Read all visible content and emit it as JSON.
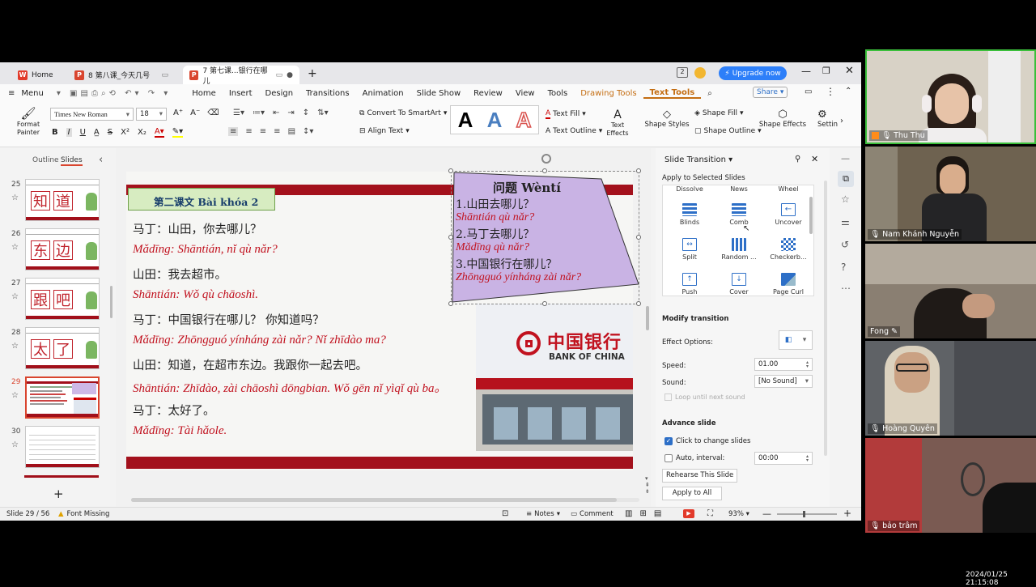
{
  "tabs": {
    "home": "Home",
    "doc1": "8 第八课_今天几号",
    "doc2": "7 第七课...银行在哪儿",
    "new_tab": "+"
  },
  "titlebar": {
    "upgrade": "Upgrade now",
    "badge": "2"
  },
  "menubar": {
    "menu": "Menu",
    "items": [
      "Home",
      "Insert",
      "Design",
      "Transitions",
      "Animation",
      "Slide Show",
      "Review",
      "View",
      "Tools",
      "Drawing Tools",
      "Text Tools"
    ],
    "share": "Share"
  },
  "ribbon": {
    "format_painter": "Format Painter",
    "font_name": "Times New Roman",
    "font_size": "18",
    "convert_smartart": "Convert To SmartArt",
    "align_text": "Align Text",
    "text_fill": "Text Fill",
    "text_outline": "Text Outline",
    "text_effects": "Text Effects",
    "shape_styles": "Shape Styles",
    "shape_fill": "Shape Fill",
    "shape_outline": "Shape Outline",
    "shape_effects": "Shape Effects",
    "settings": "Settin"
  },
  "sidebar": {
    "outline_tab": "Outline",
    "slides_tab": "Slides",
    "slides": [
      {
        "num": "25",
        "chars": [
          "知",
          "道"
        ]
      },
      {
        "num": "26",
        "chars": [
          "东",
          "边"
        ]
      },
      {
        "num": "27",
        "chars": [
          "跟",
          "吧"
        ]
      },
      {
        "num": "28",
        "chars": [
          "太",
          "了"
        ]
      },
      {
        "num": "29",
        "chars": []
      },
      {
        "num": "30",
        "chars": []
      }
    ],
    "add": "+"
  },
  "slide": {
    "title": "第二课文  Bài khóa 2",
    "lines": [
      {
        "cn": "马丁：山田，你去哪儿？",
        "py": "Mǎdīng: Shāntián, nǐ qù nǎr?"
      },
      {
        "cn": "山田：我去超市。",
        "py": "Shāntián: Wǒ qù chāoshì."
      },
      {
        "cn": "马丁：中国银行在哪儿？  你知道吗？",
        "py": "Mǎdīng: Zhōngguó yínháng zài nǎr? Nǐ zhīdào ma?"
      },
      {
        "cn": "山田：知道，在超市东边。我跟你一起去吧。",
        "py": "Shāntián: Zhīdào, zài chāoshì dōngbian. Wǒ gēn nǐ yìqǐ qù ba。"
      },
      {
        "cn": "马丁：太好了。",
        "py": "Mǎdīng: Tài hǎole."
      }
    ],
    "wenti": {
      "title": "问题 Wèntí",
      "items": [
        {
          "cn": "1.山田去哪儿？",
          "py": "Shāntián qù nǎr?"
        },
        {
          "cn": "2.马丁去哪儿？",
          "py": "Mǎdīng qù nǎr?"
        },
        {
          "cn": "3.中国银行在哪儿？",
          "py": "Zhōngguó yínháng zài nǎr?"
        }
      ]
    },
    "bank": {
      "cn": "中国银行",
      "en": "BANK OF CHINA"
    }
  },
  "panel": {
    "title": "Slide Transition",
    "apply_selected": "Apply to Selected Slides",
    "top_row": [
      "Dissolve",
      "News",
      "Wheel"
    ],
    "transitions": [
      "Blinds",
      "Comb",
      "Uncover",
      "Split",
      "Random ...",
      "Checkerb...",
      "Push",
      "Cover",
      "Page Curl"
    ],
    "modify": "Modify transition",
    "effect_options": "Effect Options:",
    "speed_label": "Speed:",
    "speed_value": "01.00",
    "sound_label": "Sound:",
    "sound_value": "[No Sound]",
    "loop": "Loop until next sound",
    "advance": "Advance slide",
    "click_change": "Click to change slides",
    "click_checked": true,
    "auto_interval": "Auto, interval:",
    "interval_value": "00:00",
    "rehearse": "Rehearse This Slide",
    "apply_all": "Apply to All"
  },
  "status": {
    "slide": "Slide 29 / 56",
    "font_missing": "Font Missing",
    "notes": "Notes",
    "comment": "Comment",
    "zoom": "93%"
  },
  "participants": [
    {
      "name": "Thu Thu",
      "bg": "#d8d2c6"
    },
    {
      "name": "Nam Khánh Nguyễn",
      "bg": "#6e6250"
    },
    {
      "name": "Fong",
      "bg": "#8a7f72"
    },
    {
      "name": "Hoàng Quyên",
      "bg": "#5f6266"
    },
    {
      "name": "bảo trâm",
      "bg": "#7a5a52"
    }
  ],
  "timestamp": "2024/01/25 21:15:08"
}
